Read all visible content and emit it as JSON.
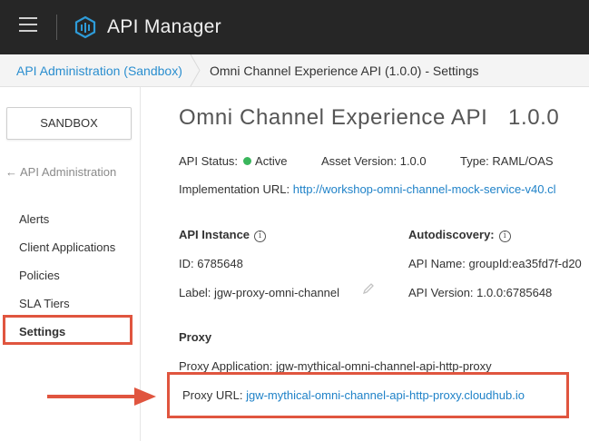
{
  "app": {
    "title": "API Manager"
  },
  "breadcrumb": {
    "root": "API Administration (Sandbox)",
    "current": "Omni Channel Experience API (1.0.0) - Settings"
  },
  "sidebar": {
    "environment_button": "SANDBOX",
    "back_link": "API Administration",
    "items": [
      {
        "label": "Alerts"
      },
      {
        "label": "Client Applications"
      },
      {
        "label": "Policies"
      },
      {
        "label": "SLA Tiers"
      },
      {
        "label": "Settings",
        "active": true
      }
    ]
  },
  "api": {
    "name": "Omni Channel Experience API",
    "version": "1.0.0",
    "status_label": "API Status:",
    "status_value": "Active",
    "asset_version": "Asset Version: 1.0.0",
    "type": "Type: RAML/OAS",
    "implementation_label": "Implementation URL:",
    "implementation_url": "http://workshop-omni-channel-mock-service-v40.cl"
  },
  "instance": {
    "title": "API Instance",
    "id": "ID: 6785648",
    "label": "Label: jgw-proxy-omni-channel"
  },
  "autodiscovery": {
    "title": "Autodiscovery:",
    "api_name": "API Name: groupId:ea35fd7f-d20",
    "api_version": "API Version: 1.0.0:6785648"
  },
  "proxy": {
    "title": "Proxy",
    "application": "Proxy Application: jgw-mythical-omni-channel-api-http-proxy",
    "url_label": "Proxy URL:",
    "url": "jgw-mythical-omni-channel-api-http-proxy.cloudhub.io"
  },
  "colors": {
    "accent_link": "#1f82c8",
    "highlight": "#e0553f",
    "status_active": "#3ab65c",
    "topbar": "#262626"
  }
}
